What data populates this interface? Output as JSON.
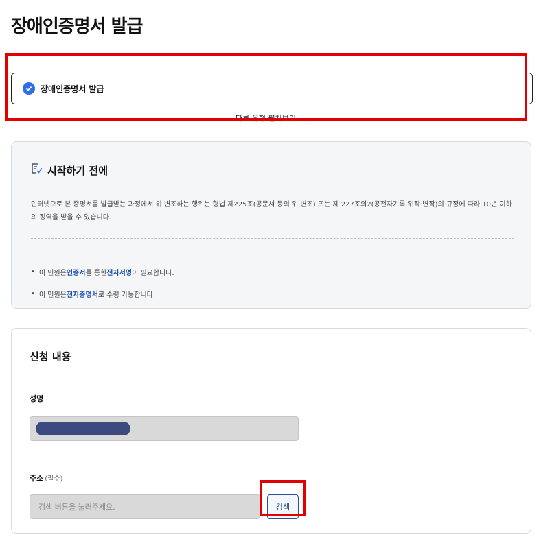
{
  "page": {
    "title": "장애인증명서 발급"
  },
  "type_selector": {
    "selected_label": "장애인증명서 발급",
    "expand_label": "다른 유형 펼쳐보기"
  },
  "before_start": {
    "title": "시작하기 전에",
    "description": "인터넷으로 본 증명서를 발급받는 과정에서 위·변조하는 행위는 형법 제225조(공문서 등의 위·변조) 또는 제 227조의2(공전자기록 위작·변작)의 규정에 따라 10년 이하의 징역을 받을 수 있습니다.",
    "notice1": {
      "prefix": "이 민원은 ",
      "em1": "인증서",
      "mid": "를 통한 ",
      "em2": "전자서명",
      "suffix": "이 필요합니다."
    },
    "notice2": {
      "prefix": "이 민원은 ",
      "em1": "전자증명서",
      "suffix": "로 수령 가능합니다."
    }
  },
  "application": {
    "title": "신청 내용",
    "name_label": "성명",
    "address_label": "주소",
    "address_hint": "(필수)",
    "address_placeholder": "검색 버튼을 눌러주세요.",
    "search_button": "검색"
  },
  "colors": {
    "accent": "#2f6fe6",
    "highlight": "#e00000",
    "emphasis": "#1d4fb3",
    "masked": "#3c4a80"
  }
}
